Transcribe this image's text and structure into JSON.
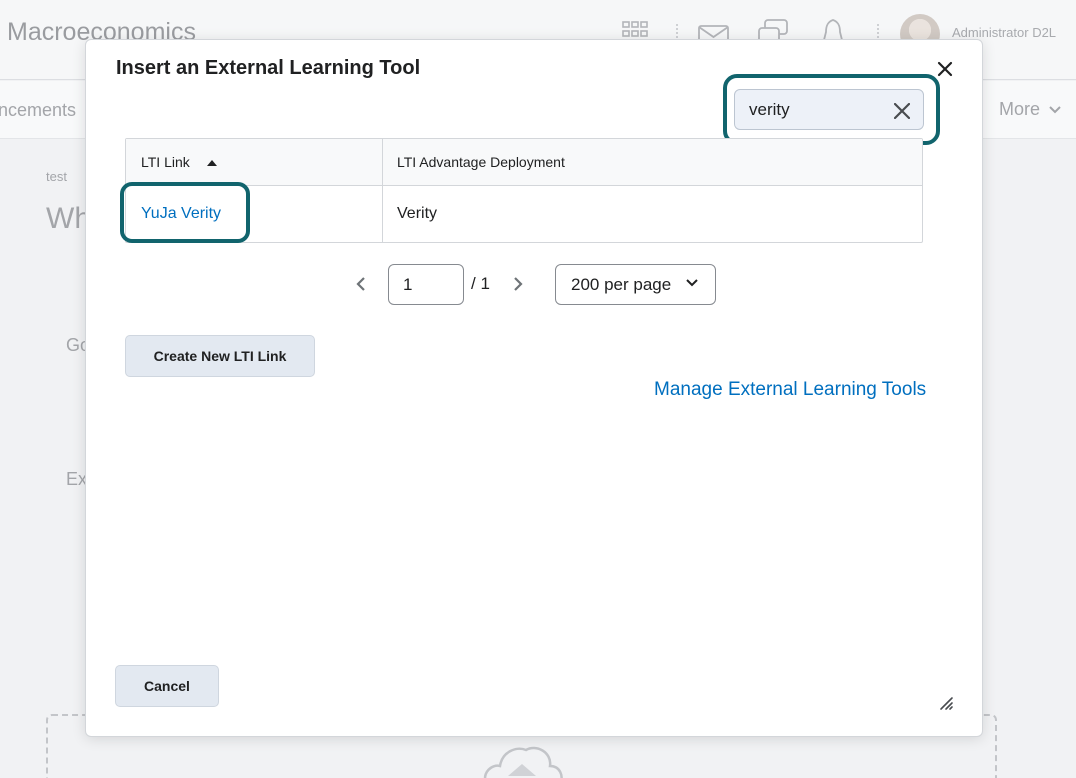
{
  "background": {
    "course_title": "Macroeconomics",
    "user_name": "Administrator D2L",
    "nav": {
      "partial_item": "ncements",
      "more_label": "More"
    },
    "breadcrumb": "test",
    "heading_fragment": "Wh",
    "label_fragment_1": "Go",
    "label_fragment_2": "Ex"
  },
  "dialog": {
    "title": "Insert an External Learning Tool",
    "search": {
      "value": "verity"
    },
    "table": {
      "columns": [
        "LTI Link",
        "LTI Advantage Deployment"
      ],
      "sort_column": "LTI Link",
      "sort_direction": "ascending",
      "rows": [
        {
          "lti_link": "YuJa Verity",
          "deployment": "Verity"
        }
      ]
    },
    "pager": {
      "current_page": "1",
      "total_pages": "/ 1",
      "per_page": "200 per page"
    },
    "create_button": "Create New LTI Link",
    "manage_link": "Manage External Learning Tools",
    "cancel_button": "Cancel"
  },
  "colors": {
    "highlight": "#11646d",
    "link": "#006fbf",
    "button_bg": "#e3e9f1"
  },
  "icons": [
    "apps-grid-icon",
    "mail-icon",
    "chat-icon",
    "bell-icon",
    "close-icon",
    "clear-search-icon",
    "sort-ascending-icon",
    "chevron-left-icon",
    "chevron-right-icon",
    "chevron-down-icon",
    "resize-grip-icon",
    "upload-cloud-icon"
  ]
}
